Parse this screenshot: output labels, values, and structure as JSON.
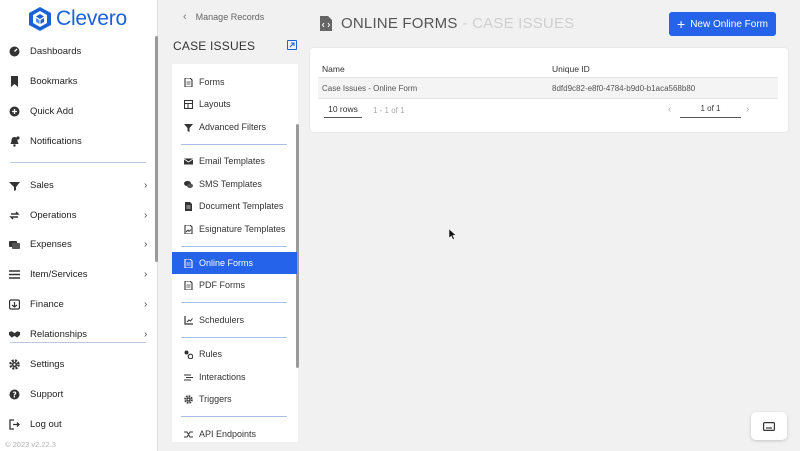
{
  "app": {
    "name": "Clevero",
    "brand_color": "#1b62d8",
    "accent": "#2563eb"
  },
  "nav": {
    "items": [
      {
        "label": "Dashboards",
        "icon": "dashboard-icon"
      },
      {
        "label": "Bookmarks",
        "icon": "bookmark-icon"
      },
      {
        "label": "Quick Add",
        "icon": "plus-circle-icon"
      },
      {
        "label": "Notifications",
        "icon": "bell-icon"
      },
      {
        "label": "Sales",
        "icon": "sales-icon"
      },
      {
        "label": "Operations",
        "icon": "operations-icon"
      },
      {
        "label": "Expenses",
        "icon": "expenses-icon"
      },
      {
        "label": "Item/Services",
        "icon": "list-icon"
      },
      {
        "label": "Finance",
        "icon": "finance-icon"
      },
      {
        "label": "Relationships",
        "icon": "handshake-icon"
      },
      {
        "label": "Settings",
        "icon": "gear-icon"
      },
      {
        "label": "Support",
        "icon": "help-icon"
      },
      {
        "label": "Log out",
        "icon": "logout-icon"
      }
    ],
    "copyright": "© 2023  v2.22.3"
  },
  "breadcrumb": {
    "label": "Manage Records"
  },
  "section": {
    "title": "CASE ISSUES"
  },
  "menu": {
    "items": [
      {
        "label": "Forms"
      },
      {
        "label": "Layouts"
      },
      {
        "label": "Advanced Filters"
      },
      {
        "label": "Email Templates"
      },
      {
        "label": "SMS Templates"
      },
      {
        "label": "Document Templates"
      },
      {
        "label": "Esignature Templates"
      },
      {
        "label": "Online Forms"
      },
      {
        "label": "PDF Forms"
      },
      {
        "label": "Schedulers"
      },
      {
        "label": "Rules"
      },
      {
        "label": "Interactions"
      },
      {
        "label": "Triggers"
      },
      {
        "label": "API Endpoints"
      }
    ],
    "active": "Online Forms"
  },
  "header": {
    "title": "ONLINE FORMS",
    "subtitle": "- CASE ISSUES",
    "new_button": "New Online Form"
  },
  "table": {
    "columns": [
      "Name",
      "Unique ID"
    ],
    "rows": [
      {
        "name": "Case Issues - Online Form",
        "id": "8dfd9c82-e8f0-4784-b9d0-b1aca568b80"
      }
    ],
    "rows_per_page": "10 rows",
    "range": "1 - 1 of 1",
    "page": "1 of 1"
  }
}
